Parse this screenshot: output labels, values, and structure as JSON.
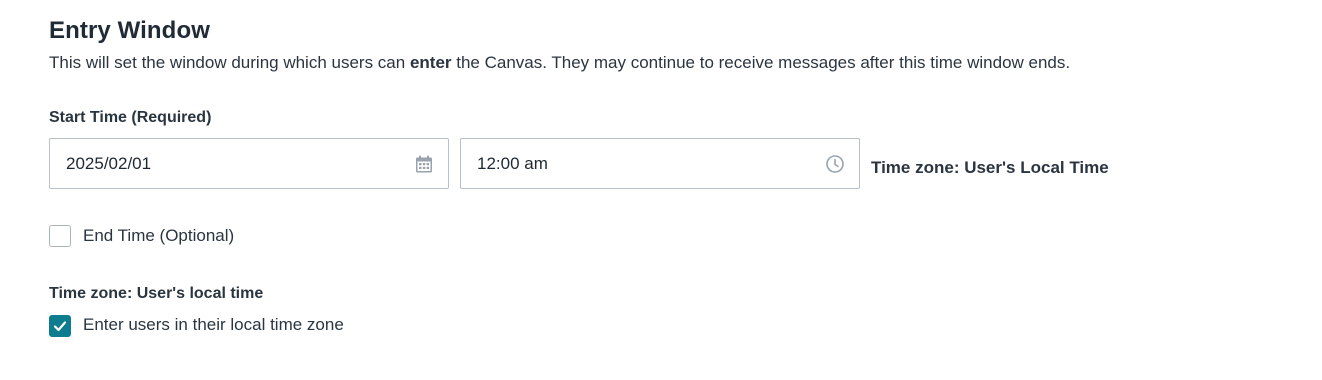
{
  "section": {
    "title": "Entry Window",
    "description_prefix": "This will set the window during which users can ",
    "description_bold": "enter",
    "description_suffix": " the Canvas. They may continue to receive messages after this time window ends."
  },
  "start_time": {
    "label": "Start Time (Required)",
    "date_value": "2025/02/01",
    "date_icon": "calendar-icon",
    "time_value": "12:00 am",
    "time_icon": "clock-icon",
    "timezone_note": "Time zone: User's Local Time"
  },
  "end_time": {
    "label": "End Time (Optional)",
    "checked": false
  },
  "timezone": {
    "heading": "Time zone: User's local time",
    "option_label": "Enter users in their local time zone",
    "checked": true
  },
  "colors": {
    "accent": "#0d7c8f",
    "border": "#b9c0c8",
    "text": "#2b3540",
    "icon": "#9aa3ad"
  }
}
